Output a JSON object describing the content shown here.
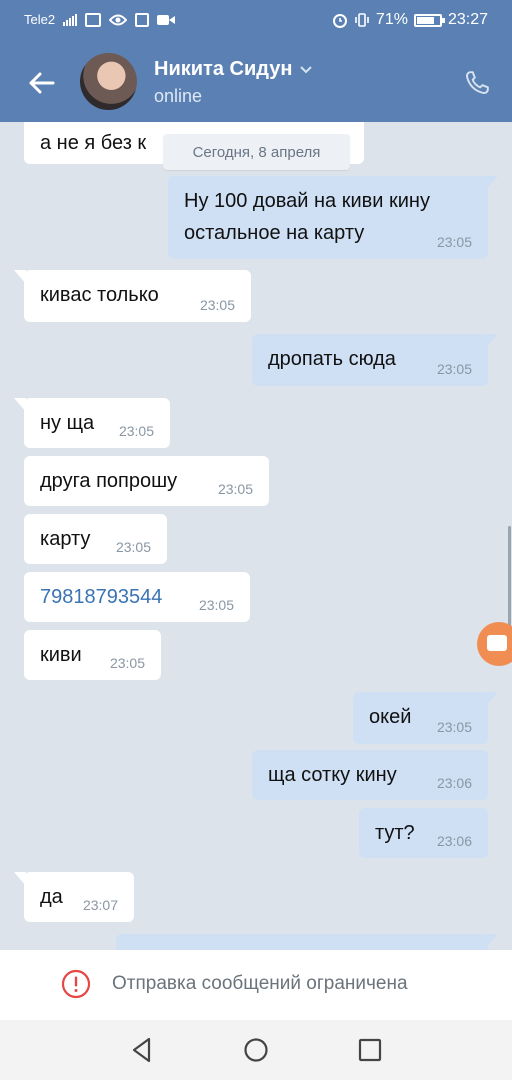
{
  "status_bar": {
    "carrier": "Tele2",
    "battery_percent": "71%",
    "time": "23:27",
    "icons": [
      "signal-icon",
      "cast-icon",
      "eye-icon",
      "nfc-icon",
      "video-icon",
      "alarm-icon",
      "vibrate-icon",
      "battery-icon"
    ]
  },
  "header": {
    "contact_name": "Никита Сидун",
    "presence": "online"
  },
  "chat": {
    "date_chip": "Сегодня, 8 апреля",
    "partial_top_message": "а не я без к",
    "messages": [
      {
        "dir": "out",
        "text_lines": [
          "Ну 100 довай на киви кину",
          "остальное на карту"
        ],
        "time": "23:05"
      },
      {
        "dir": "in",
        "text": "кивас только",
        "time": "23:05"
      },
      {
        "dir": "out",
        "text": "дропать сюда",
        "time": "23:05"
      },
      {
        "dir": "in",
        "text": "ну ща",
        "time": "23:05"
      },
      {
        "dir": "in",
        "text": "друга попрошу",
        "time": "23:05"
      },
      {
        "dir": "in",
        "text": "карту",
        "time": "23:05"
      },
      {
        "dir": "in",
        "text": "79818793544",
        "time": "23:05",
        "is_link": true
      },
      {
        "dir": "in",
        "text": "киви",
        "time": "23:05"
      },
      {
        "dir": "out",
        "text": "окей",
        "time": "23:05"
      },
      {
        "dir": "out",
        "text": "ща сотку кину",
        "time": "23:06"
      },
      {
        "dir": "out",
        "text": "тут?",
        "time": "23:06"
      },
      {
        "dir": "in",
        "text": "да",
        "time": "23:07"
      }
    ]
  },
  "restriction": {
    "text": "Отправка сообщений ограничена"
  },
  "colors": {
    "header_bg": "#5b81b4",
    "chat_bg": "#dde3ea",
    "incoming_bubble": "#ffffff",
    "outgoing_bubble": "#cfe0f5",
    "link": "#3a74b5",
    "warning_red": "#e64646",
    "fab": "#ef8d53"
  }
}
